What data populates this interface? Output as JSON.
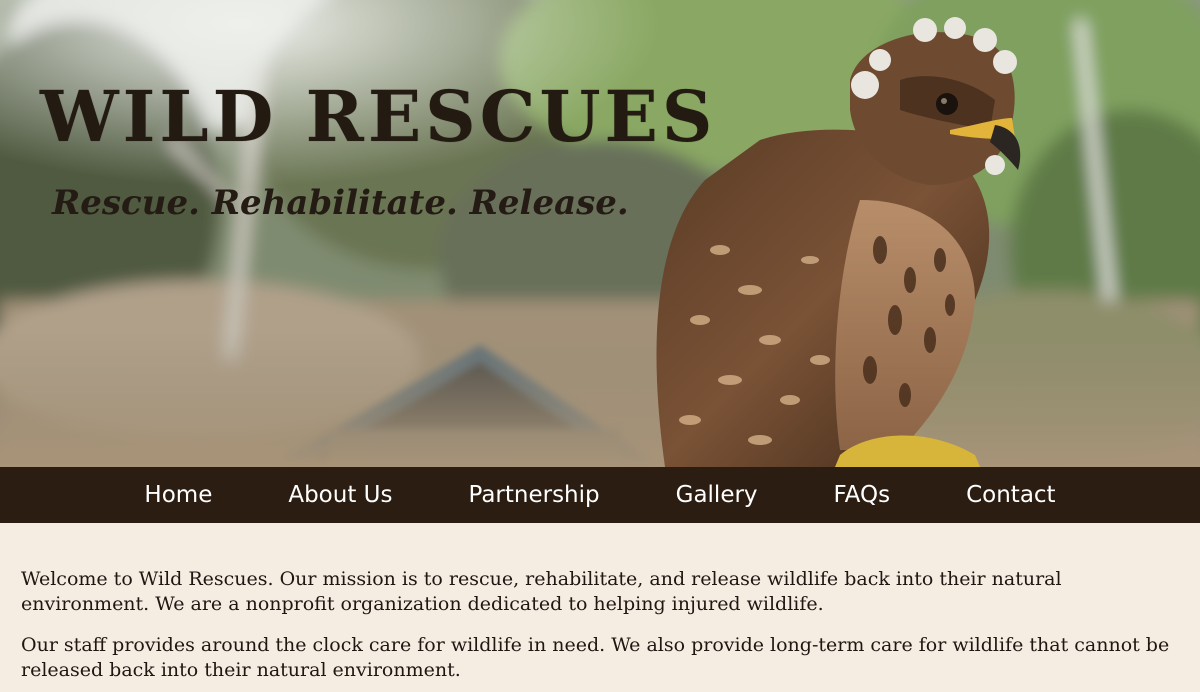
{
  "header": {
    "title": "WILD RESCUES",
    "tagline": "Rescue. Rehabilitate. Release.",
    "image_icon": "hawk-photo-icon"
  },
  "nav": {
    "items": [
      {
        "label": "Home"
      },
      {
        "label": "About Us"
      },
      {
        "label": "Partnership"
      },
      {
        "label": "Gallery"
      },
      {
        "label": "FAQs"
      },
      {
        "label": "Contact"
      }
    ]
  },
  "main": {
    "paragraphs": [
      "Welcome to Wild Rescues. Our mission is to rescue, rehabilitate, and release wildlife back into their natural environment. We are a nonprofit organization dedicated to helping injured wildlife.",
      "Our staff provides around the clock care for wildlife in need. We also provide long-term care for wildlife that cannot be released back into their natural environment."
    ]
  },
  "colors": {
    "nav_background": "#2c1d12",
    "page_background": "#f6ede2",
    "title_color": "#231a12"
  }
}
